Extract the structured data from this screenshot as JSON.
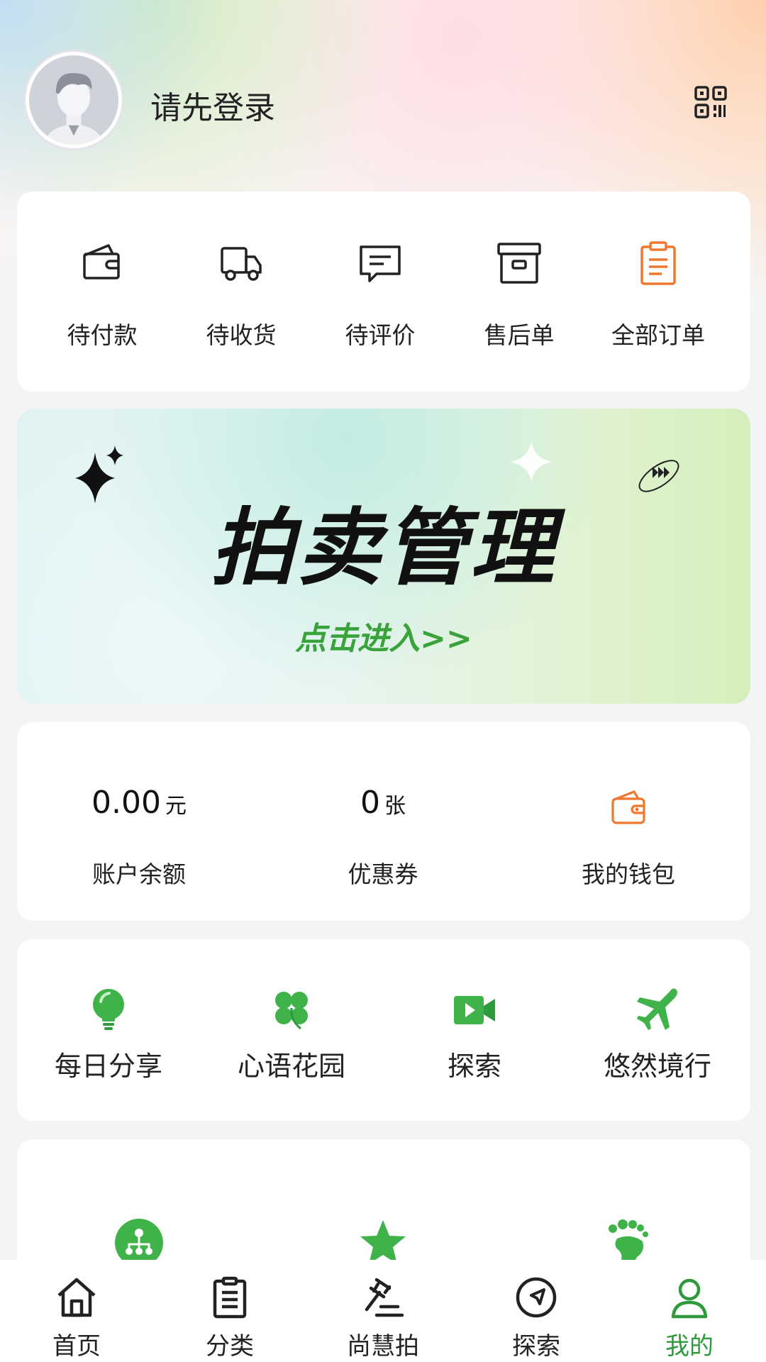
{
  "header": {
    "login_prompt": "请先登录"
  },
  "orders": [
    {
      "label": "待付款",
      "icon": "wallet-icon"
    },
    {
      "label": "待收货",
      "icon": "truck-icon"
    },
    {
      "label": "待评价",
      "icon": "comment-icon"
    },
    {
      "label": "售后单",
      "icon": "archive-box-icon"
    },
    {
      "label": "全部订单",
      "icon": "clipboard-icon"
    }
  ],
  "banner": {
    "title": "拍卖管理",
    "subtitle": "点击进入>>"
  },
  "wallet": {
    "balance": {
      "value": "0.00",
      "unit": "元",
      "label": "账户余额"
    },
    "coupons": {
      "value": "0",
      "unit": "张",
      "label": "优惠券"
    },
    "my_wallet": {
      "label": "我的钱包",
      "icon": "wallet-icon"
    }
  },
  "features": [
    {
      "label": "每日分享",
      "icon": "lightbulb-icon"
    },
    {
      "label": "心语花园",
      "icon": "clover-icon"
    },
    {
      "label": "探索",
      "icon": "video-camera-icon"
    },
    {
      "label": "悠然境行",
      "icon": "airplane-icon"
    }
  ],
  "more_icons": [
    "network-icon",
    "star-icon",
    "footprint-icon"
  ],
  "tabbar": [
    {
      "label": "首页",
      "icon": "home-icon"
    },
    {
      "label": "分类",
      "icon": "list-icon"
    },
    {
      "label": "尚慧拍",
      "icon": "gavel-icon"
    },
    {
      "label": "探索",
      "icon": "compass-icon"
    },
    {
      "label": "我的",
      "icon": "user-icon",
      "active": true
    }
  ],
  "colors": {
    "accent_green": "#2f9a3c",
    "accent_orange": "#f0782e"
  }
}
